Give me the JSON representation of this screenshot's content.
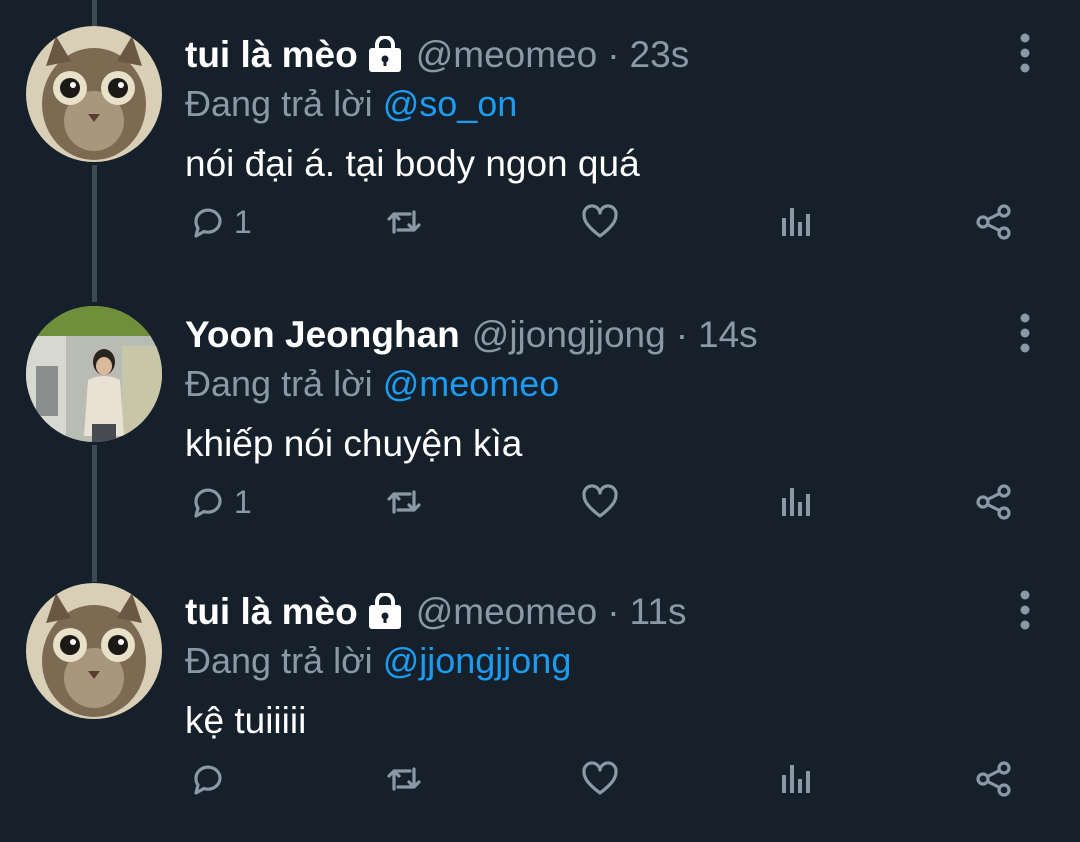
{
  "tweets": [
    {
      "name": "tui là mèo",
      "verified_lock": true,
      "handle": "@meomeo",
      "separator": "·",
      "time": "23s",
      "replying_label": "Đang trả lời",
      "replying_to": "@so_on",
      "text": "nói đại á. tại body ngon quá",
      "reply_count": "1",
      "avatar": "cat-avatar"
    },
    {
      "name": "Yoon Jeonghan",
      "verified_lock": false,
      "handle": "@jjongjjong",
      "separator": "·",
      "time": "14s",
      "replying_label": "Đang trả lời",
      "replying_to": "@meomeo",
      "text": "khiếp nói chuyện kìa",
      "reply_count": "1",
      "avatar": "person-avatar"
    },
    {
      "name": "tui là mèo",
      "verified_lock": true,
      "handle": "@meomeo",
      "separator": "·",
      "time": "11s",
      "replying_label": "Đang trả lời",
      "replying_to": "@jjongjjong",
      "text": "kệ tuiiiii",
      "reply_count": "",
      "avatar": "cat-avatar"
    }
  ],
  "icons": {
    "reply": "reply-icon",
    "retweet": "retweet-icon",
    "like": "like-icon",
    "views": "views-icon",
    "share": "share-icon",
    "more": "more-vertical-icon",
    "lock": "lock-icon"
  },
  "colors": {
    "background": "#15202b",
    "text": "#ffffff",
    "secondary": "#8b98a5",
    "mention": "#1d9bf0",
    "thread_line": "#3d4a56"
  }
}
